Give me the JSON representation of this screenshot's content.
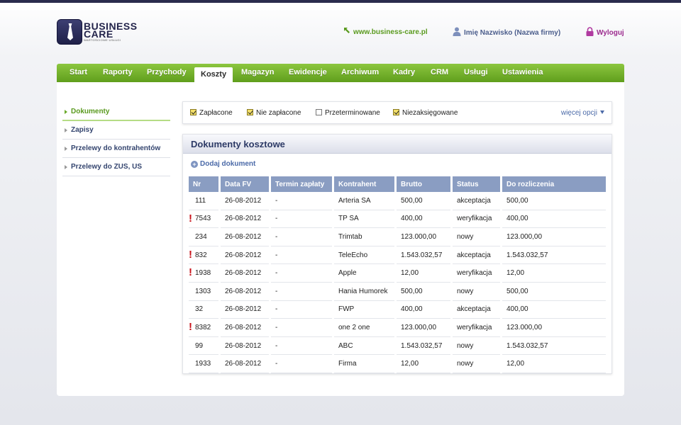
{
  "brand": {
    "name_line1": "Business",
    "name_line2": "Care",
    "tagline": "WARTOŚCIOWE USŁUGI"
  },
  "header": {
    "site_link": "www.business-care.pl",
    "user": "Imię Nazwisko (Nazwa firmy)",
    "logout": "Wyloguj"
  },
  "nav": [
    "Start",
    "Raporty",
    "Przychody",
    "Koszty",
    "Magazyn",
    "Ewidencje",
    "Archiwum",
    "Kadry",
    "CRM",
    "Usługi",
    "Ustawienia"
  ],
  "nav_active": "Koszty",
  "sidebar": {
    "items": [
      {
        "label": "Dokumenty",
        "active": true
      },
      {
        "label": "Zapisy",
        "active": false
      },
      {
        "label": "Przelewy do kontrahentów",
        "active": false
      },
      {
        "label": "Przelewy do ZUS, US",
        "active": false
      }
    ]
  },
  "filters": {
    "items": [
      {
        "label": "Zapłacone",
        "checked": true
      },
      {
        "label": "Nie zapłacone",
        "checked": true
      },
      {
        "label": "Przeterminowane",
        "checked": false
      },
      {
        "label": "Niezaksięgowane",
        "checked": true
      }
    ],
    "more": "więcej opcji"
  },
  "docs": {
    "title": "Dokumenty kosztowe",
    "add": "Dodaj dokument",
    "columns": [
      "Nr",
      "Data FV",
      "Termin zapłaty",
      "Kontrahent",
      "Brutto",
      "Status",
      "Do rozliczenia"
    ],
    "rows": [
      {
        "flag": false,
        "nr": "111",
        "date": "26-08-2012",
        "due": "-",
        "contractor": "Arteria SA",
        "gross": "500,00",
        "status": "akceptacja",
        "settle": "500,00"
      },
      {
        "flag": true,
        "nr": "7543",
        "date": "26-08-2012",
        "due": "-",
        "contractor": "TP SA",
        "gross": "400,00",
        "status": "weryfikacja",
        "settle": "400,00"
      },
      {
        "flag": false,
        "nr": "234",
        "date": "26-08-2012",
        "due": "-",
        "contractor": "Trimtab",
        "gross": "123.000,00",
        "status": "nowy",
        "settle": "123.000,00"
      },
      {
        "flag": true,
        "nr": "832",
        "date": "26-08-2012",
        "due": "-",
        "contractor": "TeleEcho",
        "gross": "1.543.032,57",
        "status": "akceptacja",
        "settle": "1.543.032,57"
      },
      {
        "flag": true,
        "nr": "1938",
        "date": "26-08-2012",
        "due": "-",
        "contractor": "Apple",
        "gross": "12,00",
        "status": "weryfikacja",
        "settle": "12,00"
      },
      {
        "flag": false,
        "nr": "1303",
        "date": "26-08-2012",
        "due": "-",
        "contractor": "Hania Humorek",
        "gross": "500,00",
        "status": "nowy",
        "settle": "500,00"
      },
      {
        "flag": false,
        "nr": "32",
        "date": "26-08-2012",
        "due": "-",
        "contractor": "FWP",
        "gross": "400,00",
        "status": "akceptacja",
        "settle": "400,00"
      },
      {
        "flag": true,
        "nr": "8382",
        "date": "26-08-2012",
        "due": "-",
        "contractor": "one 2 one",
        "gross": "123.000,00",
        "status": "weryfikacja",
        "settle": "123.000,00"
      },
      {
        "flag": false,
        "nr": "99",
        "date": "26-08-2012",
        "due": "-",
        "contractor": "ABC",
        "gross": "1.543.032,57",
        "status": "nowy",
        "settle": "1.543.032,57"
      },
      {
        "flag": false,
        "nr": "1933",
        "date": "26-08-2012",
        "due": "-",
        "contractor": "Firma",
        "gross": "12,00",
        "status": "nowy",
        "settle": "12,00"
      }
    ]
  },
  "colors": {
    "accent_green": "#6aaa2a",
    "nav_blue": "#2d3a66",
    "warning_red": "#c8121a",
    "logout_purple": "#9b2a8e"
  },
  "icons": {
    "site_link": "arrow-up-left-icon",
    "user": "user-icon",
    "logout": "padlock-icon",
    "warning": "exclamation-icon",
    "add": "plus-circle-icon"
  }
}
